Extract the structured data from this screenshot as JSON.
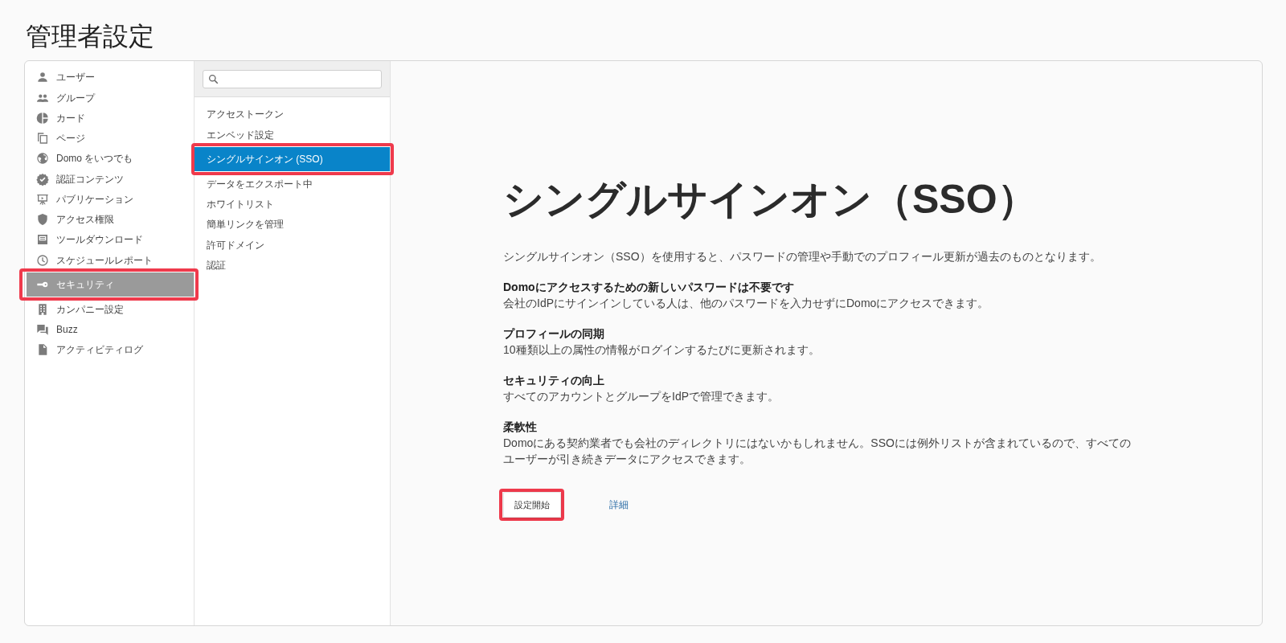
{
  "page": {
    "title": "管理者設定"
  },
  "sidebar": {
    "items": [
      {
        "label": "ユーザー",
        "selected": false,
        "highlighted": false
      },
      {
        "label": "グループ",
        "selected": false,
        "highlighted": false
      },
      {
        "label": "カード",
        "selected": false,
        "highlighted": false
      },
      {
        "label": "ページ",
        "selected": false,
        "highlighted": false
      },
      {
        "label": "Domo をいつでも",
        "selected": false,
        "highlighted": false
      },
      {
        "label": "認証コンテンツ",
        "selected": false,
        "highlighted": false
      },
      {
        "label": "パブリケーション",
        "selected": false,
        "highlighted": false
      },
      {
        "label": "アクセス権限",
        "selected": false,
        "highlighted": false
      },
      {
        "label": "ツールダウンロード",
        "selected": false,
        "highlighted": false
      },
      {
        "label": "スケジュールレポート",
        "selected": false,
        "highlighted": false
      },
      {
        "label": "セキュリティ",
        "selected": true,
        "highlighted": true
      },
      {
        "label": "カンパニー設定",
        "selected": false,
        "highlighted": false
      },
      {
        "label": "Buzz",
        "selected": false,
        "highlighted": false
      },
      {
        "label": "アクティビティログ",
        "selected": false,
        "highlighted": false
      }
    ]
  },
  "submenu": {
    "items": [
      {
        "label": "アクセストークン",
        "selected": false,
        "highlighted": false
      },
      {
        "label": "エンベッド設定",
        "selected": false,
        "highlighted": false
      },
      {
        "label": "シングルサインオン (SSO)",
        "selected": true,
        "highlighted": true
      },
      {
        "label": "データをエクスポート中",
        "selected": false,
        "highlighted": false
      },
      {
        "label": "ホワイトリスト",
        "selected": false,
        "highlighted": false
      },
      {
        "label": "簡単リンクを管理",
        "selected": false,
        "highlighted": false
      },
      {
        "label": "許可ドメイン",
        "selected": false,
        "highlighted": false
      },
      {
        "label": "認証",
        "selected": false,
        "highlighted": false
      }
    ]
  },
  "content": {
    "heading": "シングルサインオン（SSO）",
    "intro": "シングルサインオン（SSO）を使用すると、パスワードの管理や手動でのプロフィール更新が過去のものとなります。",
    "features": [
      {
        "title": "Domoにアクセスするための新しいパスワードは不要です",
        "text": "会社のIdPにサインインしている人は、他のパスワードを入力せずにDomoにアクセスできます。"
      },
      {
        "title": "プロフィールの同期",
        "text": "10種類以上の属性の情報がログインするたびに更新されます。"
      },
      {
        "title": "セキュリティの向上",
        "text": "すべてのアカウントとグループをIdPで管理できます。"
      },
      {
        "title": "柔軟性",
        "text": "Domoにある契約業者でも会社のディレクトリにはないかもしれません。SSOには例外リストが含まれているので、すべてのユーザーが引き続きデータにアクセスできます。"
      }
    ],
    "actions": [
      {
        "label": "設定開始",
        "kind": "button",
        "highlighted": true
      },
      {
        "label": "詳細",
        "kind": "link",
        "highlighted": false
      }
    ]
  }
}
